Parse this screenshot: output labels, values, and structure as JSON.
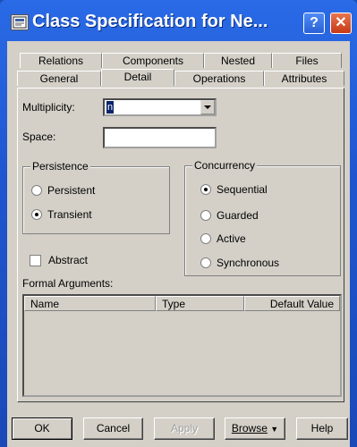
{
  "window": {
    "title": "Class Specification for Ne...",
    "help_label": "?",
    "close_label": "✕"
  },
  "tabs": {
    "row_back": [
      "Relations",
      "Components",
      "Nested",
      "Files"
    ],
    "row_front": [
      "General",
      "Detail",
      "Operations",
      "Attributes"
    ],
    "active": "Detail"
  },
  "form": {
    "multiplicity_label": "Multiplicity:",
    "multiplicity_value": "n",
    "space_label": "Space:",
    "space_value": ""
  },
  "persistence": {
    "title": "Persistence",
    "options": [
      "Persistent",
      "Transient"
    ],
    "selected": "Transient"
  },
  "concurrency": {
    "title": "Concurrency",
    "options": [
      "Sequential",
      "Guarded",
      "Active",
      "Synchronous"
    ],
    "selected": "Sequential"
  },
  "abstract_label": "Abstract",
  "formal_arguments": {
    "label": "Formal Arguments:",
    "columns": [
      "Name",
      "Type",
      "Default Value"
    ]
  },
  "buttons": {
    "ok": "OK",
    "cancel": "Cancel",
    "apply": "Apply",
    "browse": "Browse",
    "help": "Help"
  }
}
